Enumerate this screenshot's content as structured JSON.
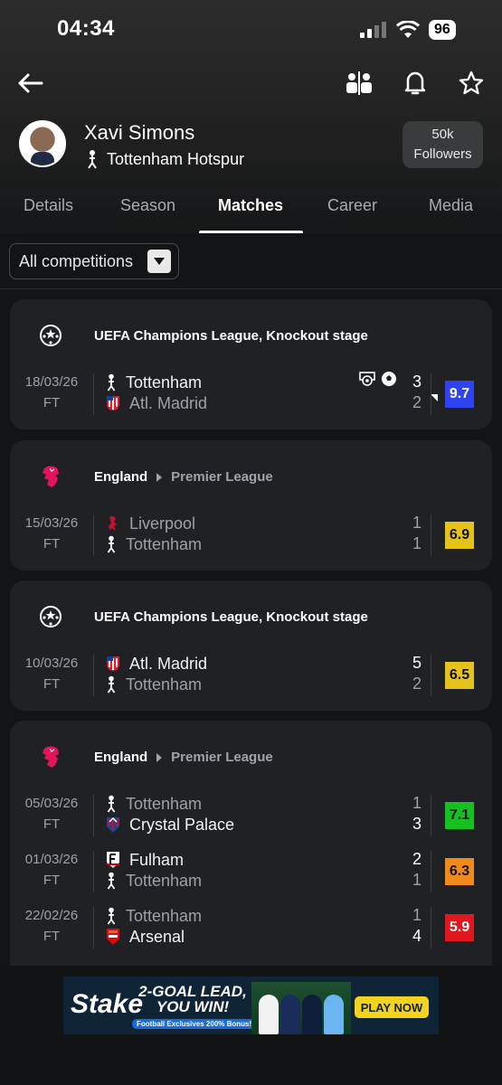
{
  "status_bar": {
    "time": "04:34",
    "battery": "96"
  },
  "player": {
    "name": "Xavi Simons",
    "team": "Tottenham Hotspur",
    "followers_count": "50k",
    "followers_label": "Followers"
  },
  "tabs": [
    {
      "label": "Details"
    },
    {
      "label": "Season"
    },
    {
      "label": "Matches",
      "active": true
    },
    {
      "label": "Career"
    },
    {
      "label": "Media"
    }
  ],
  "filter": {
    "label": "All competitions"
  },
  "rating_colors": {
    "blue": "#2f44f0",
    "yellow": "#e6c31a",
    "green": "#16c01f",
    "orange": "#f08a1a",
    "red": "#e0171f"
  },
  "cards": [
    {
      "competition": "UEFA Champions League, Knockout stage",
      "competition_icon": "champions-league-icon",
      "matches": [
        {
          "date": "18/03/26",
          "status": "FT",
          "home": "Tottenham",
          "away": "Atl. Madrid",
          "home_score": "3",
          "away_score": "2",
          "rating": "9.7",
          "rating_color": "#2f44f0"
        }
      ]
    },
    {
      "country": "England",
      "league": "Premier League",
      "competition_icon": "premier-league-icon",
      "matches": [
        {
          "date": "15/03/26",
          "status": "FT",
          "home": "Liverpool",
          "away": "Tottenham",
          "home_score": "1",
          "away_score": "1",
          "rating": "6.9",
          "rating_color": "#e6c31a"
        }
      ]
    },
    {
      "competition": "UEFA Champions League, Knockout stage",
      "competition_icon": "champions-league-icon",
      "matches": [
        {
          "date": "10/03/26",
          "status": "FT",
          "home": "Atl. Madrid",
          "away": "Tottenham",
          "home_score": "5",
          "away_score": "2",
          "rating": "6.5",
          "rating_color": "#e6c31a"
        }
      ]
    },
    {
      "country": "England",
      "league": "Premier League",
      "competition_icon": "premier-league-icon",
      "matches": [
        {
          "date": "05/03/26",
          "status": "FT",
          "home": "Tottenham",
          "away": "Crystal Palace",
          "home_score": "1",
          "away_score": "3",
          "rating": "7.1",
          "rating_color": "#16c01f"
        },
        {
          "date": "01/03/26",
          "status": "FT",
          "home": "Fulham",
          "away": "Tottenham",
          "home_score": "2",
          "away_score": "1",
          "rating": "6.3",
          "rating_color": "#f08a1a"
        },
        {
          "date": "22/02/26",
          "status": "FT",
          "home": "Tottenham",
          "away": "Arsenal",
          "home_score": "1",
          "away_score": "4",
          "rating": "5.9",
          "rating_color": "#e0171f"
        }
      ]
    }
  ],
  "ad": {
    "brand": "Stake",
    "headline": "2-GOAL LEAD, YOU WIN!",
    "subline": "Football Exclusives 200% Bonus!",
    "cta": "PLAY NOW"
  }
}
